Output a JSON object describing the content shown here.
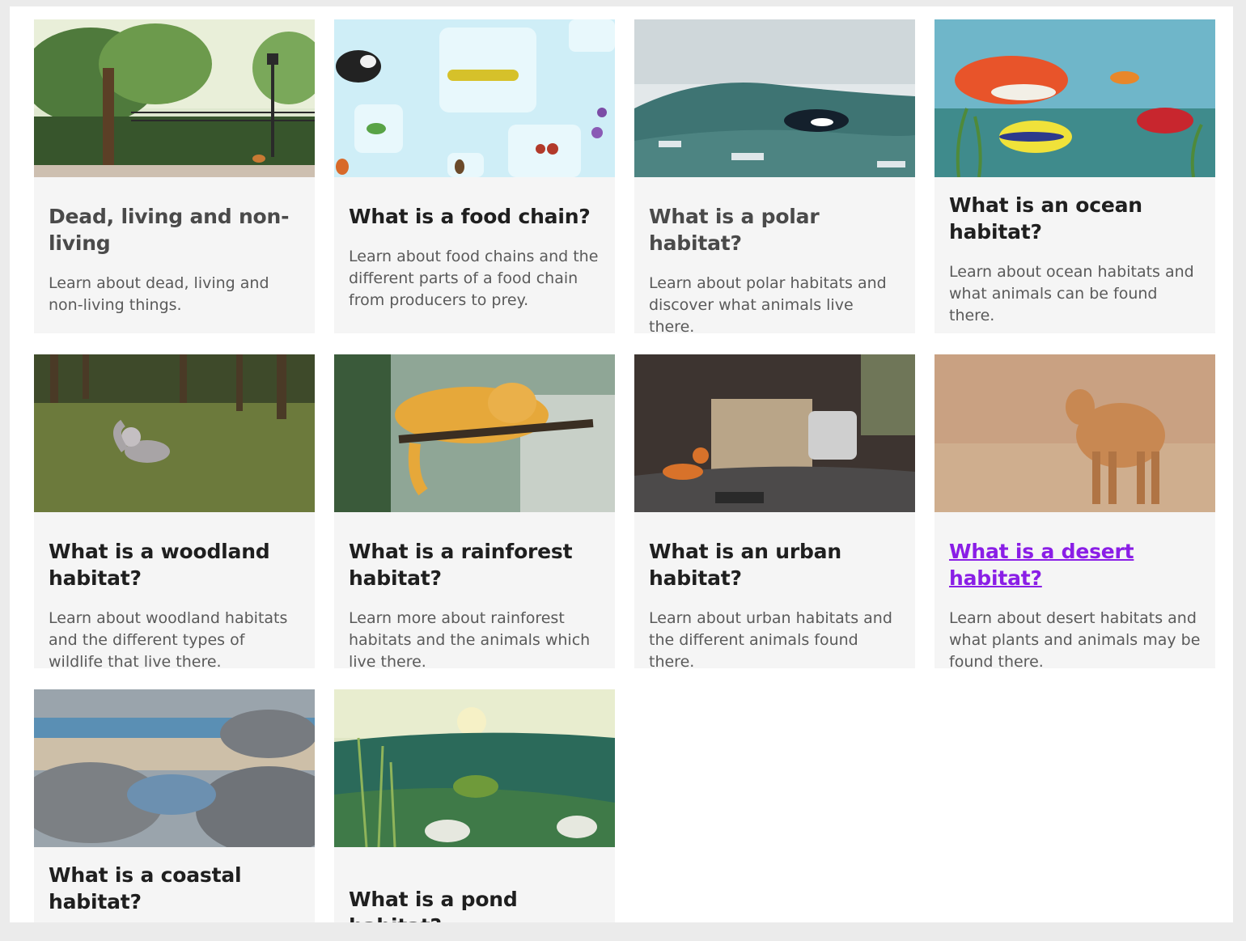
{
  "cards": [
    {
      "title": "Dead, living and non-living",
      "description": "Learn about dead, living and non-living things."
    },
    {
      "title": "What is a food chain?",
      "description": "Learn about food chains and the different parts of a food chain from producers to prey."
    },
    {
      "title": "What is a polar habitat?",
      "description": "Learn about polar habitats and discover what animals live there."
    },
    {
      "title": "What is an ocean habitat?",
      "description": "Learn about ocean habitats and what animals can be found there."
    },
    {
      "title": "What is a woodland habitat?",
      "description": "Learn about woodland habitats and the different types of wildlife that live there."
    },
    {
      "title": "What is a rainforest habitat?",
      "description": "Learn more about rainforest habitats and the animals which live there."
    },
    {
      "title": "What is an urban habitat?",
      "description": "Learn about urban habitats and the different animals found there."
    },
    {
      "title": "What is a desert habitat?",
      "description": "Learn about desert habitats and what plants and animals may be found there."
    },
    {
      "title": "What is a coastal habitat?",
      "description": ""
    },
    {
      "title": "What is a pond habitat?",
      "description": ""
    }
  ],
  "colors": {
    "visited_link": "#8a1ee6",
    "card_bg": "#f5f5f5",
    "title_text": "#1f1f1f",
    "body_text": "#5a5a5a"
  }
}
